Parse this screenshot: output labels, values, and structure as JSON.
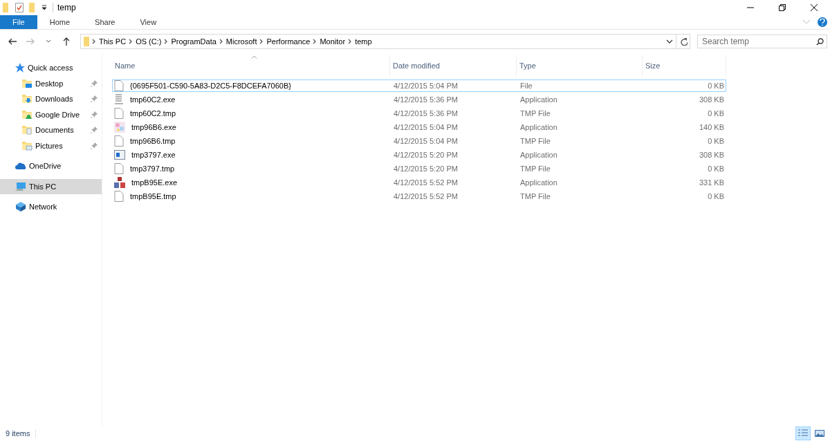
{
  "window": {
    "title": "temp"
  },
  "ribbon_tabs": [
    {
      "label": "File",
      "kind": "backstage"
    },
    {
      "label": "Home",
      "kind": "tab"
    },
    {
      "label": "Share",
      "kind": "tab"
    },
    {
      "label": "View",
      "kind": "tab"
    }
  ],
  "address_bar": {
    "path": [
      "This PC",
      "OS (C:)",
      "ProgramData",
      "Microsoft",
      "Performance",
      "Monitor",
      "temp"
    ]
  },
  "search": {
    "placeholder": "Search temp"
  },
  "sidebar": {
    "items": [
      {
        "label": "Quick access",
        "kind": "star",
        "selected": false,
        "children": [
          {
            "label": "Desktop",
            "kind": "desktop",
            "pinned": true,
            "selected": false
          },
          {
            "label": "Downloads",
            "kind": "downloads",
            "pinned": true,
            "selected": false
          },
          {
            "label": "Google Drive",
            "kind": "drive",
            "pinned": true,
            "selected": false
          },
          {
            "label": "Documents",
            "kind": "documents",
            "pinned": true,
            "selected": false
          },
          {
            "label": "Pictures",
            "kind": "pictures",
            "pinned": true,
            "selected": false
          }
        ]
      },
      {
        "label": "OneDrive",
        "kind": "cloud",
        "selected": false
      },
      {
        "label": "This PC",
        "kind": "pc",
        "selected": true
      },
      {
        "label": "Network",
        "kind": "network",
        "selected": false
      }
    ]
  },
  "table": {
    "columns": [
      {
        "label": "Name",
        "sorted": true
      },
      {
        "label": "Date modified",
        "sorted": false
      },
      {
        "label": "Type",
        "sorted": false
      },
      {
        "label": "Size",
        "sorted": false
      }
    ],
    "rows": [
      {
        "name": "{0695F501-C590-5A83-D2C5-F8DCEFA7060B}",
        "date": "4/12/2015 5:04 PM",
        "type": "File",
        "size": "0 KB",
        "kind": "blank",
        "focused": true
      },
      {
        "name": "tmp60C2.exe",
        "date": "4/12/2015 5:36 PM",
        "type": "Application",
        "size": "308 KB",
        "kind": "text-app",
        "focused": false
      },
      {
        "name": "tmp60C2.tmp",
        "date": "4/12/2015 5:36 PM",
        "type": "TMP File",
        "size": "0 KB",
        "kind": "blank",
        "focused": false
      },
      {
        "name": "tmp96B6.exe",
        "date": "4/12/2015 5:04 PM",
        "type": "Application",
        "size": "140 KB",
        "kind": "colorful-app",
        "focused": false
      },
      {
        "name": "tmp96B6.tmp",
        "date": "4/12/2015 5:04 PM",
        "type": "TMP File",
        "size": "0 KB",
        "kind": "blank",
        "focused": false
      },
      {
        "name": "tmp3797.exe",
        "date": "4/12/2015 5:20 PM",
        "type": "Application",
        "size": "308 KB",
        "kind": "window-app",
        "focused": false
      },
      {
        "name": "tmp3797.tmp",
        "date": "4/12/2015 5:20 PM",
        "type": "TMP File",
        "size": "0 KB",
        "kind": "blank",
        "focused": false
      },
      {
        "name": "tmpB95E.exe",
        "date": "4/12/2015 5:52 PM",
        "type": "Application",
        "size": "331 KB",
        "kind": "blocks-app",
        "focused": false
      },
      {
        "name": "tmpB95E.tmp",
        "date": "4/12/2015 5:52 PM",
        "type": "TMP File",
        "size": "0 KB",
        "kind": "blank",
        "focused": false
      }
    ]
  },
  "status_bar": {
    "count": "9 items",
    "views": [
      {
        "kind": "details",
        "selected": true
      },
      {
        "kind": "large-icons",
        "selected": false
      }
    ]
  }
}
